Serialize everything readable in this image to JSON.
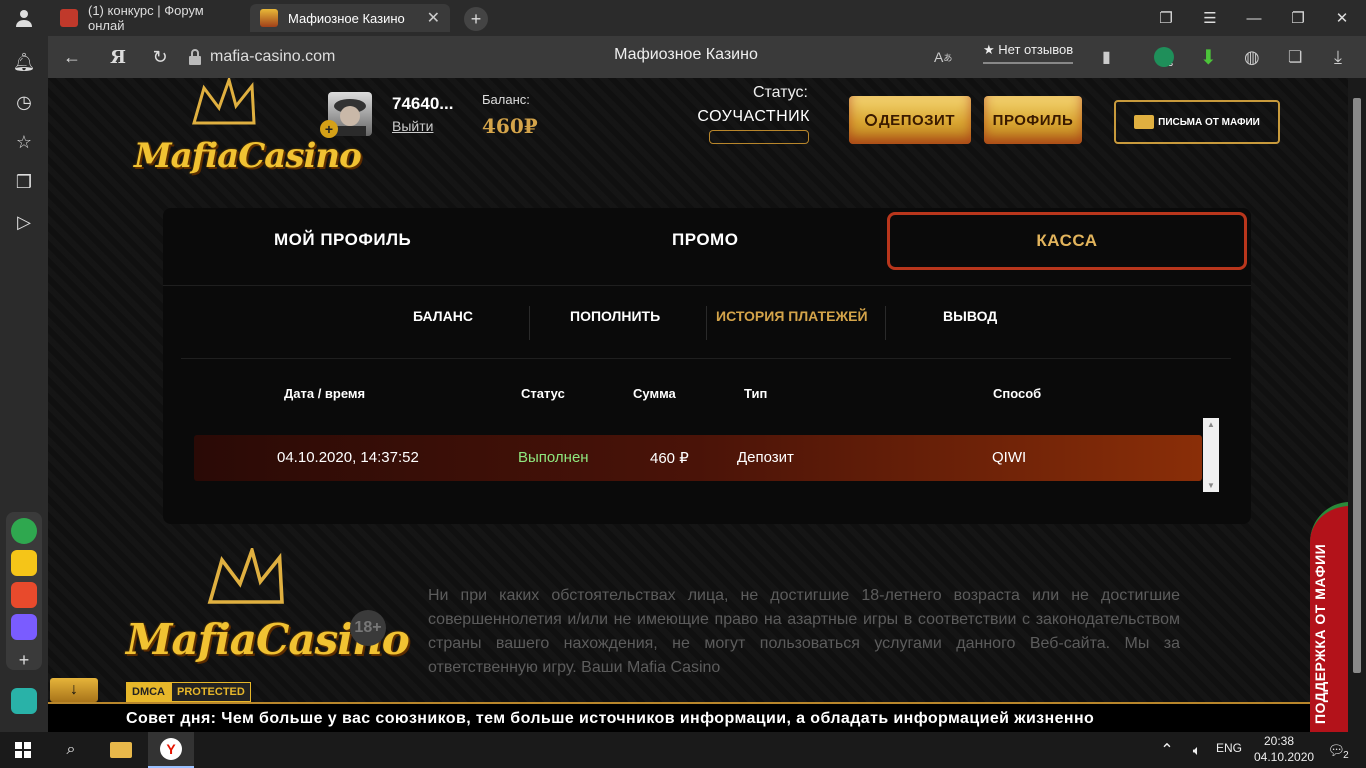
{
  "browser": {
    "tabs": [
      {
        "title": "(1) конкурс | Форум онлай"
      },
      {
        "title": "Мафиозное Казино"
      }
    ],
    "url": "mafia-casino.com",
    "page_title": "Мафиозное Казино",
    "reviews_label": "★ Нет отзывов",
    "extension_badge": "3"
  },
  "header": {
    "logo_text": "MafiaCasino",
    "username": "74640...",
    "logout": "Выйти",
    "balance_label": "Баланс:",
    "balance_value": "460₽",
    "status_label": "Статус:",
    "status_value": "СОУЧАСТНИК",
    "deposit_button": "ДЕПОЗИТ",
    "profile_button": "ПРОФИЛЬ",
    "mail_button": "ПИСЬМА ОТ МАФИИ"
  },
  "tabs": {
    "profile": "МОЙ ПРОФИЛЬ",
    "promo": "ПРОМО",
    "kassa": "КАССА"
  },
  "subtabs": {
    "balance": "БАЛАНС",
    "topup": "ПОПОЛНИТЬ",
    "history": "ИСТОРИЯ ПЛАТЕЖЕЙ",
    "withdraw": "ВЫВОД"
  },
  "table": {
    "headers": {
      "date": "Дата / время",
      "status": "Статус",
      "amount": "Сумма",
      "type": "Тип",
      "method": "Способ"
    },
    "rows": [
      {
        "date": "04.10.2020, 14:37:52",
        "status": "Выполнен",
        "amount": "460 ₽",
        "type": "Депозит",
        "method": "QIWI"
      }
    ]
  },
  "footer": {
    "logo_text": "MafiaCasino",
    "age": "18+",
    "disclaimer": "Ни при каких обстоятельствах лица, не достигшие 18-летнего возраста или не достигшие совершеннолетия и/или не имеющие право на азартные игры в соответствии с законодательством страны вашего нахождения, не могут пользоваться услугами данного Веб-сайта. Мы за ответственную игру. Ваши Mafia Casino",
    "dmca": "DMCA",
    "protected": "PROTECTED",
    "ticker": "Совет дня: Чем больше у вас союзников, тем больше источников информации, а обладать информацией жизненно",
    "support": "ПОДДЕРЖКА ОТ МАФИИ"
  },
  "taskbar": {
    "lang": "ENG",
    "time": "20:38",
    "date": "04.10.2020",
    "notifications": "2"
  },
  "colors": {
    "gold": "#d4a44a",
    "kassa_border": "#b9361c",
    "success": "#8fe87f",
    "support_red": "#b3121a"
  }
}
